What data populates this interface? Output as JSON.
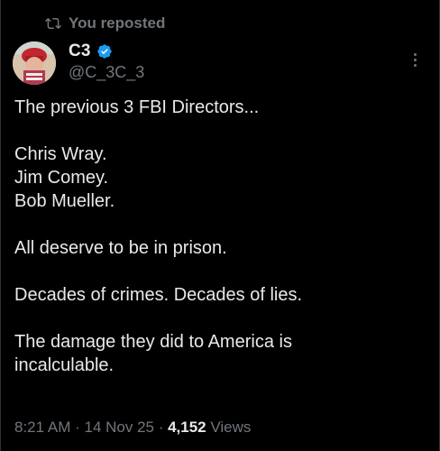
{
  "repost": {
    "label": "You reposted"
  },
  "author": {
    "display_name": "C3",
    "handle": "@C_3C_3",
    "verified_color": "#1d9bf0"
  },
  "post": {
    "lines": [
      "The previous 3 FBI Directors...",
      "",
      "Chris Wray.",
      "Jim Comey.",
      "Bob Mueller.",
      "",
      "All deserve to be in prison.",
      "",
      "Decades of crimes. Decades of lies.",
      "",
      "The damage they did to America is",
      "incalculable."
    ]
  },
  "meta": {
    "time": "8:21 AM",
    "sep1": " · ",
    "date": "14 Nov 25",
    "sep2": " · ",
    "views_count": "4,152",
    "views_label": " Views"
  },
  "colors": {
    "background": "#000000",
    "text": "#e7e9ea",
    "muted": "#71767b"
  },
  "icons": {
    "repost": "repost-icon",
    "verified": "verified-badge-icon",
    "more": "more-options-icon"
  }
}
